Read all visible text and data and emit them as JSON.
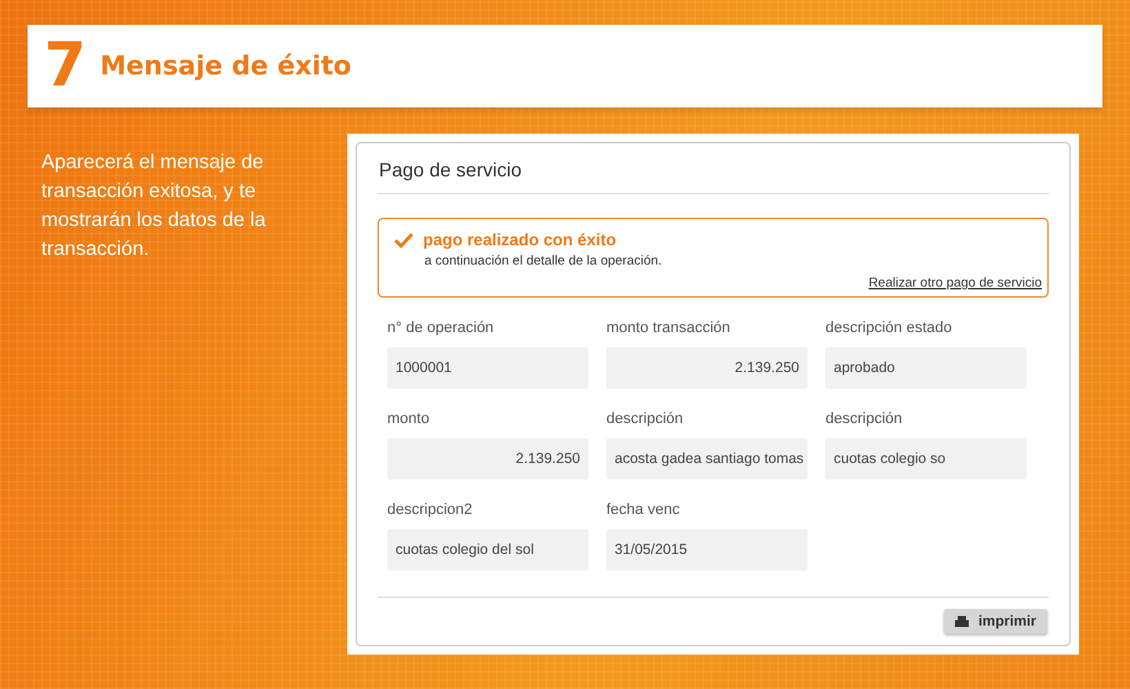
{
  "header": {
    "step": "7",
    "title": "Mensaje de éxito"
  },
  "description": "Aparecerá el mensaje de transacción exitosa, y te mostrarán los datos de la transacción.",
  "panel": {
    "title": "Pago de servicio",
    "alert": {
      "title": "pago realizado con éxito",
      "text": "a continuación el detalle de la operación.",
      "link": "Realizar otro pago de servicio"
    },
    "fields": [
      {
        "label": "n° de operación",
        "value": "1000001",
        "kind": "text"
      },
      {
        "label": "monto transacción",
        "value": "2.139.250",
        "kind": "amount"
      },
      {
        "label": "descripción estado",
        "value": "aprobado",
        "kind": "text"
      },
      {
        "label": "monto",
        "value": "2.139.250",
        "kind": "amount"
      },
      {
        "label": "descripción",
        "value": "acosta gadea santiago tomas",
        "kind": "text"
      },
      {
        "label": "descripción",
        "value": "cuotas colegio so",
        "kind": "text"
      },
      {
        "label": "descripcion2",
        "value": "cuotas colegio del sol",
        "kind": "text"
      },
      {
        "label": "fecha venc",
        "value": "31/05/2015",
        "kind": "text"
      }
    ],
    "print_button": "imprimir"
  }
}
